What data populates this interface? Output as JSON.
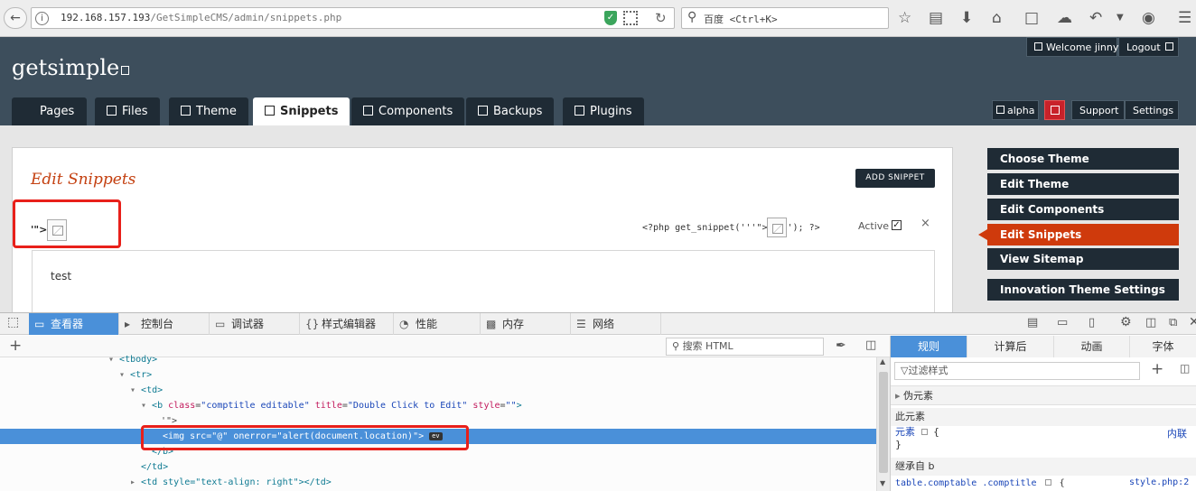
{
  "browser": {
    "url_host": "192.168.157.193",
    "url_path": "/GetSimpleCMS/admin/snippets.php",
    "search_placeholder": "百度 <Ctrl+K>"
  },
  "cms": {
    "logo": "getsimple",
    "welcome": "Welcome jinny",
    "logout": "Logout",
    "tabs": [
      "Pages",
      "Files",
      "Theme",
      "Snippets",
      "Components",
      "Backups",
      "Plugins"
    ],
    "active_tab": "Snippets",
    "badge_alpha": "alpha",
    "support": "Support",
    "settings": "Settings",
    "page_title": "Edit Snippets",
    "add_snippet": "ADD SNIPPET",
    "snippet_name_prefix": "'\">",
    "snippet_code_pre": "<?php get_snippet('''\">",
    "snippet_code_post": "'); ?>",
    "active_label": "Active",
    "close_glyph": "×",
    "snippet_content": "test",
    "sidebar": [
      "Choose Theme",
      "Edit Theme",
      "Edit Components",
      "Edit Snippets",
      "View Sitemap",
      "Innovation Theme Settings"
    ],
    "sidebar_active": "Edit Snippets"
  },
  "devtools": {
    "tabs": [
      "查看器",
      "控制台",
      "调试器",
      "样式编辑器",
      "性能",
      "内存",
      "网络"
    ],
    "active_tab": "查看器",
    "html_search_placeholder": "搜索 HTML",
    "markup": {
      "tbody": "<tbody>",
      "tr": "<tr>",
      "td": "<td>",
      "b_tag": "b",
      "b_attr_class": "class",
      "b_class_val": "comptitle editable",
      "b_attr_title": "title",
      "b_title_val": "Double Click to Edit",
      "b_attr_style": "style",
      "b_style_val": "",
      "text_node": "'\">",
      "img_tag": "img",
      "img_attr_src": "src",
      "img_src_val": "@",
      "img_attr_onerror": "onerror",
      "img_onerror_val": "alert(document.location)",
      "ev_badge": "ev",
      "b_close": "</b>",
      "td_close": "</td>",
      "next_row": "<td style=\"text-align: right\"></td>"
    },
    "side_tabs": [
      "规则",
      "计算后",
      "动画",
      "字体"
    ],
    "side_active": "规则",
    "filter_placeholder": "过滤样式",
    "pseudo": "伪元素",
    "this_element": "此元素",
    "element_label": "元素",
    "element_brace_open": "{",
    "element_brace_close": "}",
    "inline_label": "内联",
    "inherited": "继承自 b",
    "rule_selector": "table.comptable .comptitle",
    "rule_source": "style.php:2"
  },
  "colors": {
    "header_bg": "#3d4e5c",
    "accent_orange": "#cf3a0c",
    "highlight_red": "#e8201a",
    "devtools_blue": "#4a90d9"
  }
}
